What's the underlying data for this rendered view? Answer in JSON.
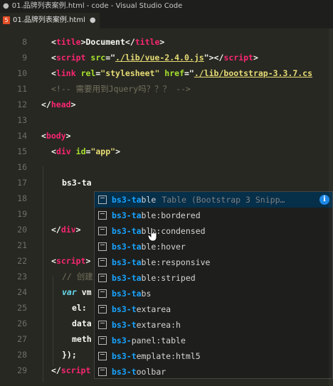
{
  "window": {
    "title": "01.品牌列表案例.html - code - Visual Studio Code",
    "dirty_dot": "●"
  },
  "tab": {
    "icon_text": "5",
    "label": "01.品牌列表案例.html",
    "close_glyph": "●"
  },
  "lines": [
    {
      "num": "8"
    },
    {
      "num": "9"
    },
    {
      "num": "10"
    },
    {
      "num": "11"
    },
    {
      "num": "12"
    },
    {
      "num": "13"
    },
    {
      "num": "14"
    },
    {
      "num": "15"
    },
    {
      "num": "16"
    },
    {
      "num": "17"
    },
    {
      "num": "18"
    },
    {
      "num": "19"
    },
    {
      "num": "20"
    },
    {
      "num": "21"
    },
    {
      "num": "22"
    },
    {
      "num": "23"
    },
    {
      "num": "24"
    },
    {
      "num": "25"
    },
    {
      "num": "26"
    },
    {
      "num": "27"
    },
    {
      "num": "28"
    },
    {
      "num": "29"
    }
  ],
  "code": {
    "l8": {
      "open": "<",
      "tag": "title",
      "close": ">",
      "text": "Document",
      "end_open": "</",
      "end_tag": "title",
      "end_close": ">"
    },
    "l9": {
      "open": "<",
      "tag": "script",
      "attr": " src",
      "eq": "=\"",
      "val": "./lib/vue-2.4.0.js",
      "q": "\"",
      "close": "></",
      "end_tag": "script",
      "end_close": ">"
    },
    "l10": {
      "open": "<",
      "tag": "link",
      "attr1": " rel",
      "eq1": "=",
      "val1": "\"stylesheet\"",
      "attr2": " href",
      "eq2": "=\"",
      "val2": "./lib/bootstrap-3.3.7.cs"
    },
    "l11": {
      "comment": "<!-- 需要用到Jquery吗？？？ -->"
    },
    "l12": {
      "open": "</",
      "tag": "head",
      "close": ">"
    },
    "l14": {
      "open": "<",
      "tag": "body",
      "close": ">"
    },
    "l15": {
      "open": "<",
      "tag": "div",
      "attr": " id",
      "eq": "=",
      "val": "\"app\"",
      "close": ">"
    },
    "l17": {
      "text": "bs3-ta"
    },
    "l20": {
      "open": "</",
      "tag": "div",
      "close": ">"
    },
    "l22": {
      "open": "<",
      "tag": "script",
      "close": ">"
    },
    "l23": {
      "comment": "// 创建"
    },
    "l24": {
      "kw": "var",
      "text": " vm"
    },
    "l25": {
      "text": "el:"
    },
    "l26": {
      "text": "data"
    },
    "l27": {
      "text": "meth"
    },
    "l28": {
      "text": "});"
    },
    "l29": {
      "open": "</",
      "tag": "script"
    }
  },
  "suggestions": [
    {
      "match": "bs3-ta",
      "rest": "ble",
      "detail": "Table (Bootstrap 3 Snipp…",
      "selected": true
    },
    {
      "match": "bs3-ta",
      "rest": "ble:bordered"
    },
    {
      "match": "bs3-ta",
      "rest": "ble:condensed"
    },
    {
      "match": "bs3-ta",
      "rest": "ble:hover"
    },
    {
      "match": "bs3-ta",
      "rest": "ble:responsive"
    },
    {
      "match": "bs3-ta",
      "rest": "ble:striped"
    },
    {
      "match": "bs3-ta",
      "rest": "bs"
    },
    {
      "match": "bs3-t",
      "rest": "extarea"
    },
    {
      "match": "bs3-t",
      "rest": "extarea:h"
    },
    {
      "match": "bs3-",
      "rest": "panel:table"
    },
    {
      "match": "bs3-t",
      "rest": "emplate:html5"
    },
    {
      "match": "bs3-t",
      "rest": "oolbar"
    }
  ],
  "info_icon": "i",
  "colors": {
    "background": "#272822",
    "tag": "#f92672",
    "attribute": "#a6e22e",
    "string": "#e6db74",
    "comment": "#75715e",
    "suggest_match": "#18a3ff",
    "suggest_selected": "#062f4a"
  }
}
